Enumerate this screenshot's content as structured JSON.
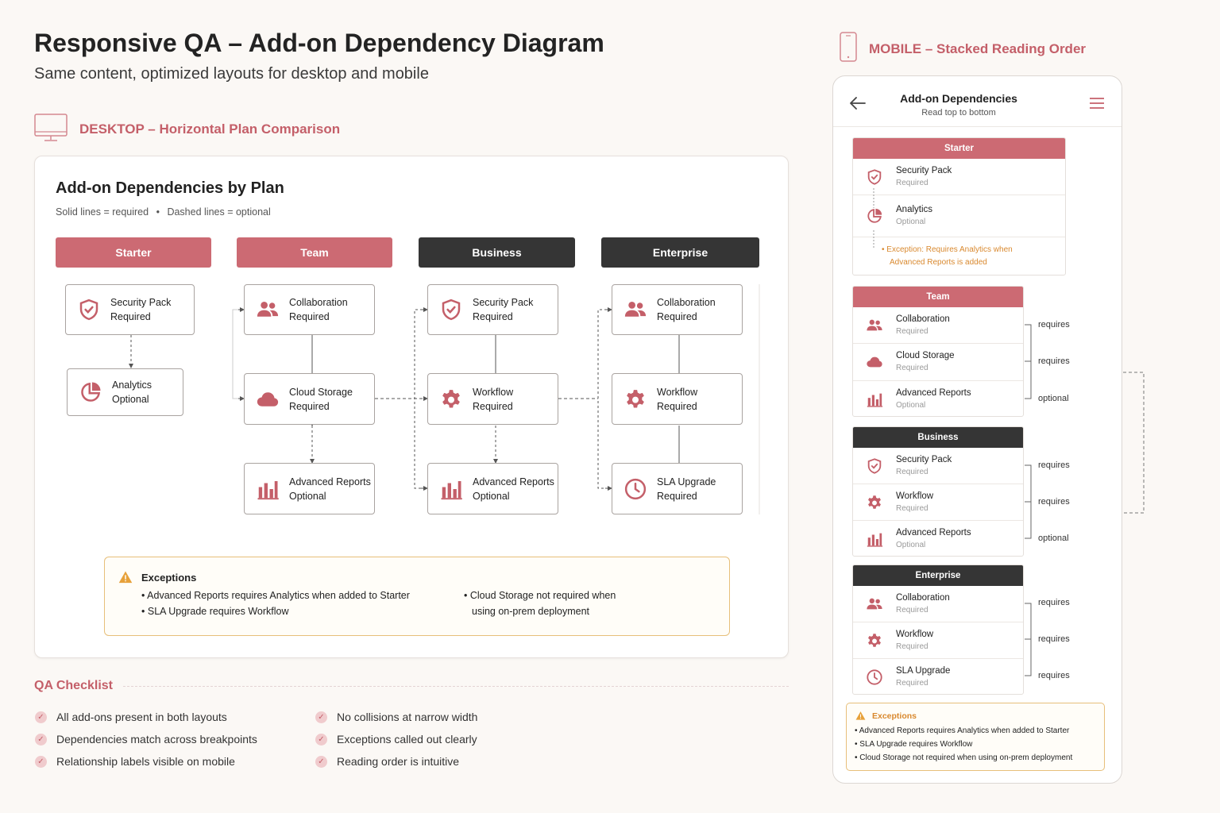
{
  "header": {
    "title": "Responsive QA – Add-on Dependency Diagram",
    "subtitle": "Same content, optimized layouts for desktop and mobile"
  },
  "desktop": {
    "section_label": "DESKTOP – Horizontal Plan Comparison",
    "panel_title": "Add-on Dependencies by Plan",
    "legend": "Solid lines = required",
    "legend_sep": "•",
    "legend2": "Dashed lines = optional",
    "plans": [
      {
        "name": "Starter",
        "style": "rose",
        "nodes": [
          {
            "name": "Security Pack",
            "status": "Required",
            "icon": "shield-icon"
          },
          {
            "name": "Analytics",
            "status": "Optional",
            "icon": "pie-chart-icon"
          }
        ]
      },
      {
        "name": "Team",
        "style": "rose",
        "nodes": [
          {
            "name": "Collaboration",
            "status": "Required",
            "icon": "users-icon"
          },
          {
            "name": "Cloud Storage",
            "status": "Required",
            "icon": "cloud-icon"
          },
          {
            "name": "Advanced Reports",
            "status": "Optional",
            "icon": "bar-chart-icon"
          }
        ]
      },
      {
        "name": "Business",
        "style": "dark",
        "nodes": [
          {
            "name": "Security Pack",
            "status": "Required",
            "icon": "shield-icon"
          },
          {
            "name": "Workflow",
            "status": "Required",
            "icon": "gear-icon"
          },
          {
            "name": "Advanced Reports",
            "status": "Optional",
            "icon": "bar-chart-icon"
          }
        ]
      },
      {
        "name": "Enterprise",
        "style": "dark",
        "nodes": [
          {
            "name": "Collaboration",
            "status": "Required",
            "icon": "users-icon"
          },
          {
            "name": "Workflow",
            "status": "Required",
            "icon": "gear-icon"
          },
          {
            "name": "SLA Upgrade",
            "status": "Required",
            "icon": "clock-icon"
          }
        ]
      }
    ],
    "exceptions": {
      "title": "Exceptions",
      "items": [
        "Advanced Reports requires Analytics when added to Starter",
        "SLA Upgrade requires Workflow",
        "Cloud Storage not required when",
        "using on-prem deployment"
      ]
    }
  },
  "checklist": {
    "title": "QA Checklist",
    "items": [
      "All add-ons present in both layouts",
      "Dependencies match across breakpoints",
      "Relationship labels visible on mobile",
      "No collisions at narrow width",
      "Exceptions called out clearly",
      "Reading order is intuitive"
    ]
  },
  "mobile": {
    "section_label": "MOBILE – Stacked Reading Order",
    "title": "Add-on Dependencies",
    "subtitle": "Read top to bottom",
    "starter_exception": "Exception: Requires Analytics when",
    "starter_exception2": "Advanced Reports is added",
    "plans": [
      {
        "name": "Starter",
        "rows": [
          {
            "name": "Security Pack",
            "status": "Required"
          },
          {
            "name": "Analytics",
            "status": "Optional"
          }
        ]
      },
      {
        "name": "Team",
        "rows": [
          {
            "name": "Collaboration",
            "status": "Required",
            "rel": "requires"
          },
          {
            "name": "Cloud Storage",
            "status": "Required",
            "rel": "requires"
          },
          {
            "name": "Advanced Reports",
            "status": "Optional",
            "rel": "optional"
          }
        ]
      },
      {
        "name": "Business",
        "rows": [
          {
            "name": "Security Pack",
            "status": "Required",
            "rel": "requires"
          },
          {
            "name": "Workflow",
            "status": "Required",
            "rel": "requires"
          },
          {
            "name": "Advanced Reports",
            "status": "Optional",
            "rel": "optional"
          }
        ]
      },
      {
        "name": "Enterprise",
        "rows": [
          {
            "name": "Collaboration",
            "status": "Required",
            "rel": "requires"
          },
          {
            "name": "Workflow",
            "status": "Required",
            "rel": "requires"
          },
          {
            "name": "SLA Upgrade",
            "status": "Required",
            "rel": "requires"
          }
        ]
      }
    ],
    "exceptions": {
      "title": "Exceptions",
      "items": [
        "Advanced Reports requires Analytics when added to Starter",
        "SLA Upgrade requires Workflow",
        "Cloud Storage not required when using on-prem deployment"
      ]
    }
  },
  "colors": {
    "rose": "#cc6a73",
    "dark": "#353535",
    "warning": "#e7a13a"
  }
}
